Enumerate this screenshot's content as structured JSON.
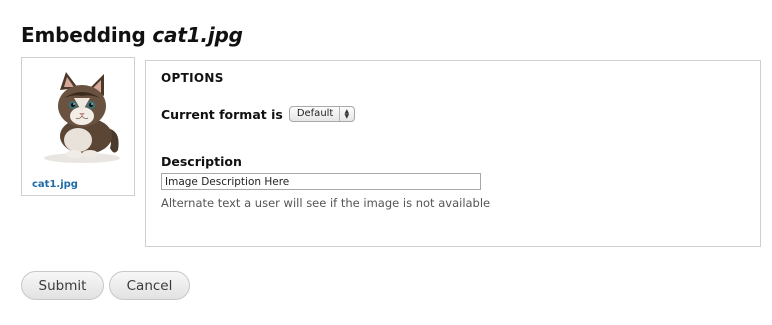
{
  "header": {
    "prefix": "Embedding",
    "filename": "cat1.jpg"
  },
  "thumbnail": {
    "caption": "cat1.jpg",
    "image_alt": "kitten photo"
  },
  "options": {
    "legend": "OPTIONS",
    "format_label": "Current format is",
    "format_value": "Default",
    "description_label": "Description",
    "description_value": "Image Description Here",
    "description_help": "Alternate text a user will see if the image is not available"
  },
  "actions": {
    "submit_label": "Submit",
    "cancel_label": "Cancel"
  },
  "colors": {
    "link": "#1f6ba8",
    "border": "#cfcfcf"
  }
}
